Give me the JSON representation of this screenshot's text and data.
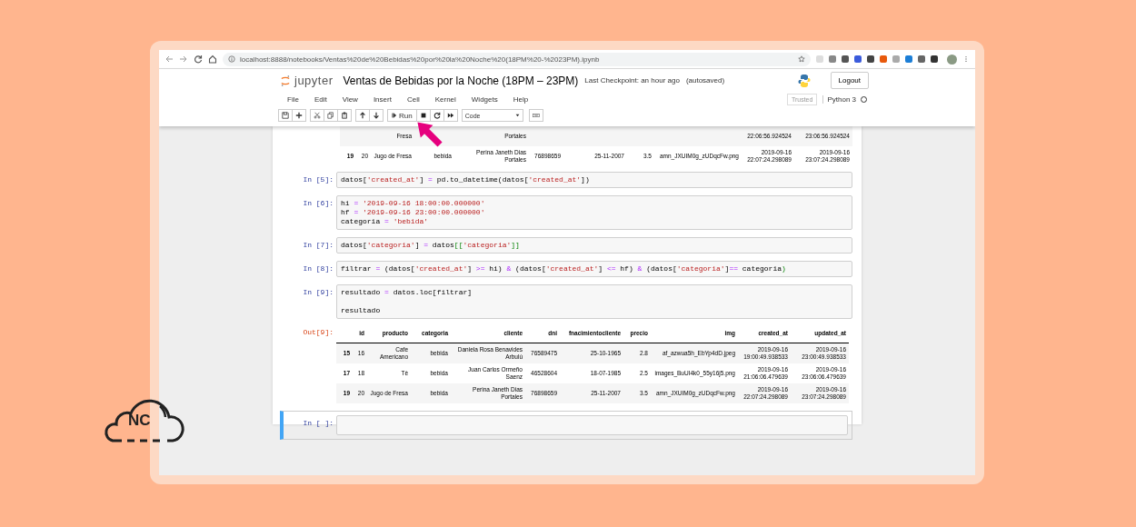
{
  "browser": {
    "url": "localhost:8888/notebooks/Ventas%20de%20Bebidas%20por%20la%20Noche%20(18PM%20-%2023PM).ipynb"
  },
  "jupyter": {
    "brand": "jupyter",
    "title": "Ventas de Bebidas por la Noche (18PM – 23PM)",
    "checkpoint": "Last Checkpoint: an hour ago",
    "autosave": "(autosaved)",
    "logout": "Logout",
    "menus": [
      "File",
      "Edit",
      "View",
      "Insert",
      "Cell",
      "Kernel",
      "Widgets",
      "Help"
    ],
    "trusted": "Trusted",
    "kernel": "Python 3",
    "run": "Run",
    "cell_type": "Code"
  },
  "previous_output": {
    "partial_row": {
      "producto": "Fresa",
      "cliente": "Portales",
      "created_at": "22:06:56.924524",
      "updated_at": "23:06:56.924524"
    },
    "last_row": [
      "19",
      "20",
      "Jugo de Fresa",
      "bebida",
      "Perina Janeth Dias Portales",
      "76898659",
      "25-11-2007",
      "3.5",
      "amn_JXUIM0g_zUDqcFw.png",
      "2019-09-16 22:07:24.298089",
      "2019-09-16 23:07:24.298089"
    ]
  },
  "cells": [
    {
      "prompt": "In [5]:",
      "lines": [
        {
          "blank_before": false,
          "segments": [
            {
              "kind": "plain",
              "text": "datos["
            },
            {
              "kind": "str",
              "text": "'created_at'"
            },
            {
              "kind": "plain",
              "text": "] "
            },
            {
              "kind": "op",
              "text": "="
            },
            {
              "kind": "plain",
              "text": " pd.to_datetime(datos["
            },
            {
              "kind": "str",
              "text": "'created_at'"
            },
            {
              "kind": "plain",
              "text": "])"
            }
          ]
        }
      ]
    },
    {
      "prompt": "In [6]:",
      "lines": [
        {
          "blank_before": false,
          "segments": [
            {
              "kind": "plain",
              "text": "hi "
            },
            {
              "kind": "op",
              "text": "="
            },
            {
              "kind": "str",
              "text": " '2019-09-16 18:00:00.000000'"
            }
          ]
        },
        {
          "blank_before": false,
          "segments": [
            {
              "kind": "plain",
              "text": "hf "
            },
            {
              "kind": "op",
              "text": "="
            },
            {
              "kind": "str",
              "text": " '2019-09-16 23:00:00.000000'"
            }
          ]
        },
        {
          "blank_before": false,
          "segments": [
            {
              "kind": "plain",
              "text": "categoria "
            },
            {
              "kind": "op",
              "text": "="
            },
            {
              "kind": "str",
              "text": " 'bebida'"
            }
          ]
        }
      ]
    },
    {
      "prompt": "In [7]:",
      "lines": [
        {
          "blank_before": false,
          "segments": [
            {
              "kind": "plain",
              "text": "datos["
            },
            {
              "kind": "str",
              "text": "'categoria'"
            },
            {
              "kind": "plain",
              "text": "] "
            },
            {
              "kind": "op",
              "text": "="
            },
            {
              "kind": "plain",
              "text": " datos"
            },
            {
              "kind": "paren",
              "text": "[["
            },
            {
              "kind": "str",
              "text": "'categoria'"
            },
            {
              "kind": "paren",
              "text": "]]"
            }
          ]
        }
      ]
    },
    {
      "prompt": "In [8]:",
      "lines": [
        {
          "blank_before": false,
          "segments": [
            {
              "kind": "plain",
              "text": "filtrar "
            },
            {
              "kind": "op",
              "text": "="
            },
            {
              "kind": "plain",
              "text": " (datos["
            },
            {
              "kind": "str",
              "text": "'created_at'"
            },
            {
              "kind": "plain",
              "text": "] "
            },
            {
              "kind": "op",
              "text": ">="
            },
            {
              "kind": "plain",
              "text": " hi) "
            },
            {
              "kind": "op",
              "text": "&"
            },
            {
              "kind": "plain",
              "text": " (datos["
            },
            {
              "kind": "str",
              "text": "'created_at'"
            },
            {
              "kind": "plain",
              "text": "] "
            },
            {
              "kind": "op",
              "text": "<="
            },
            {
              "kind": "plain",
              "text": " hf) "
            },
            {
              "kind": "op",
              "text": "&"
            },
            {
              "kind": "plain",
              "text": " (datos["
            },
            {
              "kind": "str",
              "text": "'categoria'"
            },
            {
              "kind": "plain",
              "text": "]"
            },
            {
              "kind": "op",
              "text": "=="
            },
            {
              "kind": "plain",
              "text": " categoria"
            },
            {
              "kind": "paren",
              "text": ")"
            }
          ]
        }
      ]
    },
    {
      "prompt": "In [9]:",
      "lines": [
        {
          "blank_before": false,
          "segments": [
            {
              "kind": "plain",
              "text": "resultado "
            },
            {
              "kind": "op",
              "text": "="
            },
            {
              "kind": "plain",
              "text": " datos.loc[filtrar]"
            }
          ]
        },
        {
          "blank_before": true,
          "segments": [
            {
              "kind": "plain",
              "text": "resultado"
            }
          ]
        }
      ]
    }
  ],
  "output": {
    "prompt": "Out[9]:",
    "columns": [
      "",
      "id",
      "producto",
      "categoria",
      "cliente",
      "dni",
      "fnacimientocliente",
      "precio",
      "img",
      "created_at",
      "updated_at"
    ],
    "rows": [
      [
        "15",
        "16",
        "Cafe Americano",
        "bebida",
        "Daniela Rosa Benavides Arbulú",
        "76589475",
        "25-10-1965",
        "2.8",
        "af_azwua5h_EbYp4dD.jpeg",
        "2019-09-16 19:00:49.938533",
        "2019-09-16 23:00:49.938533"
      ],
      [
        "17",
        "18",
        "Tè",
        "bebida",
        "Juan Carlos Ormeño Saenz",
        "46528604",
        "18-07-1985",
        "2.5",
        "images_BuUI4k0_55y16j5.png",
        "2019-09-16 21:06:06.479639",
        "2019-09-16 23:06:06.479639"
      ],
      [
        "19",
        "20",
        "Jugo de Fresa",
        "bebida",
        "Perina Janeth Dias Portales",
        "76898659",
        "25-11-2007",
        "3.5",
        "amn_JXUIM0g_zUDqcFw.png",
        "2019-09-16 22:07:24.298089",
        "2019-09-16 23:07:24.298089"
      ]
    ]
  },
  "empty_cell": {
    "prompt": "In [ ]:",
    "selected": true
  },
  "logo": {
    "text": "NC"
  }
}
